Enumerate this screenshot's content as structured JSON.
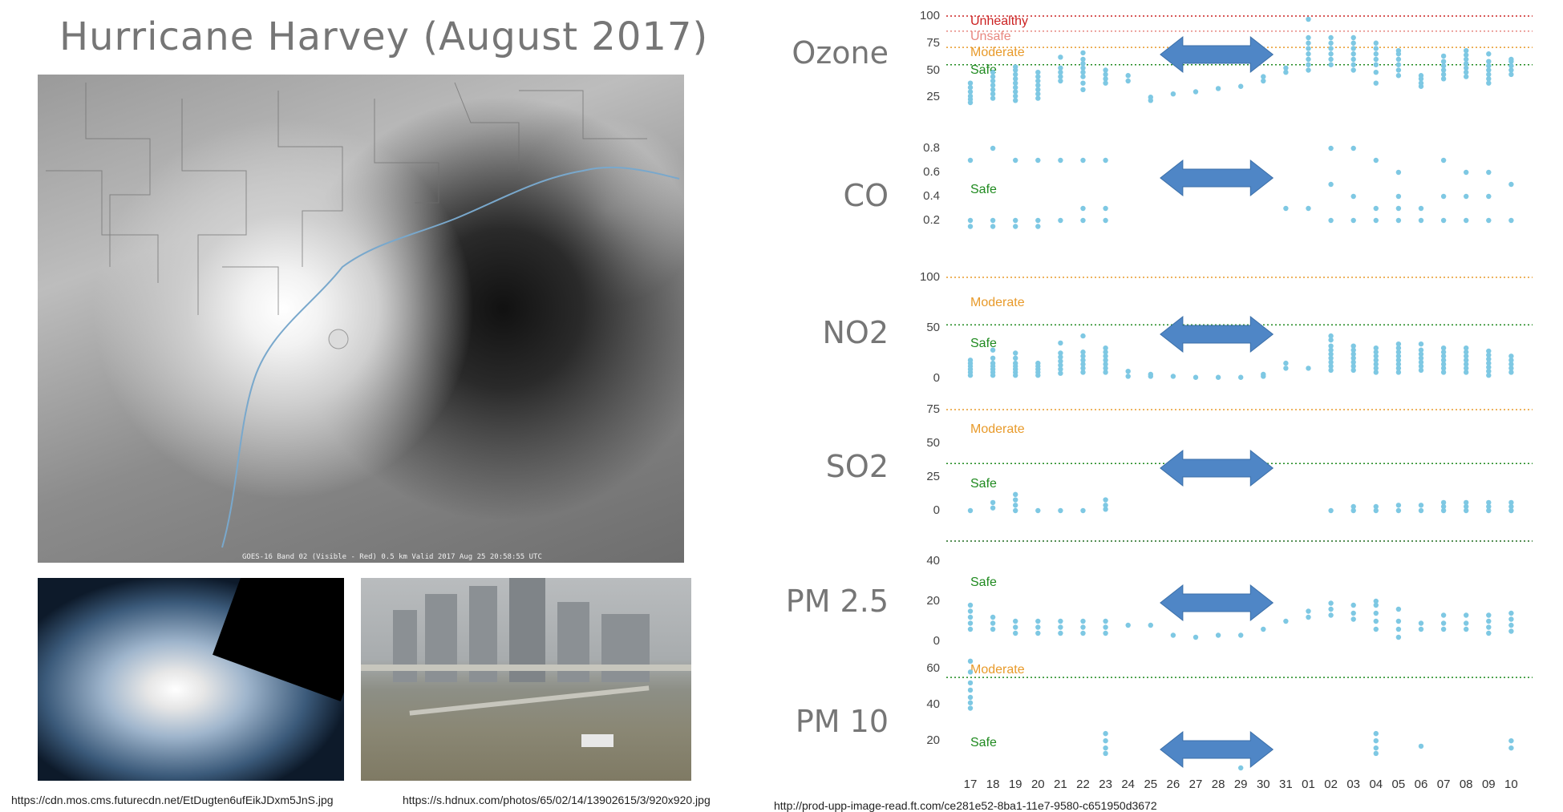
{
  "title": "Hurricane Harvey (August 2017)",
  "images": {
    "satellite_caption": "GOES-16 Band 02 (Visible - Red) 0.5 km Valid 2017 Aug 25 20:58:55 UTC"
  },
  "urls": [
    "https://cdn.mos.cms.futurecdn.net/EtDugten6ufEikJDxm5JnS.jpg",
    "https://s.hdnux.com/photos/65/02/14/13902615/3/920x920.jpg",
    "http://prod-upp-image-read.ft.com/ce281e52-8ba1-11e7-9580-c651950d3672"
  ],
  "colors": {
    "points": "#7ec8e3",
    "arrow": "#4f86c6",
    "unhealthy": "#cc2222",
    "unsafe": "#e88880",
    "moderate": "#e89a2a",
    "safe": "#1f8a1f"
  },
  "chart_data": {
    "type": "scatter",
    "x_categories": [
      "17",
      "18",
      "19",
      "20",
      "21",
      "22",
      "23",
      "24",
      "25",
      "26",
      "27",
      "28",
      "29",
      "30",
      "31",
      "01",
      "02",
      "03",
      "04",
      "05",
      "06",
      "07",
      "08",
      "09",
      "10"
    ],
    "gap_arrow": {
      "from": "26",
      "to": "30"
    },
    "panels": [
      {
        "name": "Ozone",
        "yticks": [
          "100",
          "75",
          "50",
          "25"
        ],
        "ylim": [
          0,
          100
        ],
        "thresholds": [
          {
            "label": "Unhealthy",
            "value": 100,
            "color": "#cc2222"
          },
          {
            "label": "Unsafe",
            "value": 86,
            "color": "#e88880"
          },
          {
            "label": "Moderate",
            "value": 71,
            "color": "#e89a2a"
          },
          {
            "label": "Safe",
            "value": 55,
            "color": "#1f8a1f"
          }
        ],
        "points": [
          [
            0,
            [
              20,
              23,
              26,
              30,
              34,
              38
            ]
          ],
          [
            1,
            [
              24,
              28,
              32,
              36,
              40,
              44,
              48
            ]
          ],
          [
            2,
            [
              22,
              26,
              30,
              34,
              38,
              42,
              46,
              50,
              53
            ]
          ],
          [
            3,
            [
              24,
              28,
              32,
              36,
              40,
              44,
              48
            ]
          ],
          [
            4,
            [
              40,
              44,
              48,
              52,
              62
            ]
          ],
          [
            5,
            [
              32,
              38,
              44,
              48,
              52,
              56,
              60,
              66
            ]
          ],
          [
            6,
            [
              38,
              42,
              46,
              50
            ]
          ],
          [
            7,
            [
              40,
              45
            ]
          ],
          [
            8,
            [
              22,
              25
            ]
          ],
          [
            9,
            [
              28
            ]
          ],
          [
            10,
            [
              30
            ]
          ],
          [
            11,
            [
              33
            ]
          ],
          [
            12,
            [
              35
            ]
          ],
          [
            13,
            [
              40,
              44
            ]
          ],
          [
            14,
            [
              48,
              52
            ]
          ],
          [
            15,
            [
              50,
              55,
              60,
              65,
              70,
              75,
              80,
              97
            ]
          ],
          [
            16,
            [
              55,
              60,
              65,
              70,
              75,
              80
            ]
          ],
          [
            17,
            [
              50,
              55,
              60,
              65,
              70,
              75,
              80
            ]
          ],
          [
            18,
            [
              38,
              48,
              55,
              60,
              65,
              70,
              75
            ]
          ],
          [
            19,
            [
              45,
              50,
              55,
              60,
              65,
              68
            ]
          ],
          [
            20,
            [
              35,
              38,
              42,
              45
            ]
          ],
          [
            21,
            [
              42,
              46,
              50,
              54,
              58,
              63
            ]
          ],
          [
            22,
            [
              44,
              48,
              52,
              56,
              60,
              64,
              68
            ]
          ],
          [
            23,
            [
              38,
              42,
              46,
              50,
              54,
              58,
              65
            ]
          ],
          [
            24,
            [
              46,
              50,
              54,
              58,
              60
            ]
          ]
        ]
      },
      {
        "name": "CO",
        "yticks": [
          "0.8",
          "0.6",
          "0.4",
          "0.2"
        ],
        "ylim": [
          0,
          0.9
        ],
        "thresholds": [
          {
            "label": "Safe",
            "value": 0.5,
            "color": "#1f8a1f",
            "noline": true
          }
        ],
        "points": [
          [
            0,
            [
              0.15,
              0.2,
              0.7
            ]
          ],
          [
            1,
            [
              0.15,
              0.2,
              0.8
            ]
          ],
          [
            2,
            [
              0.15,
              0.2,
              0.7
            ]
          ],
          [
            3,
            [
              0.15,
              0.2,
              0.7
            ]
          ],
          [
            4,
            [
              0.2,
              0.7
            ]
          ],
          [
            5,
            [
              0.2,
              0.3,
              0.7
            ]
          ],
          [
            6,
            [
              0.2,
              0.3,
              0.7
            ]
          ],
          [
            14,
            [
              0.3
            ]
          ],
          [
            15,
            [
              0.3
            ]
          ],
          [
            16,
            [
              0.2,
              0.5,
              0.8
            ]
          ],
          [
            17,
            [
              0.2,
              0.4,
              0.8
            ]
          ],
          [
            18,
            [
              0.2,
              0.3,
              0.7
            ]
          ],
          [
            19,
            [
              0.2,
              0.3,
              0.4,
              0.6
            ]
          ],
          [
            20,
            [
              0.2,
              0.3
            ]
          ],
          [
            21,
            [
              0.2,
              0.4,
              0.7
            ]
          ],
          [
            22,
            [
              0.2,
              0.4,
              0.6
            ]
          ],
          [
            23,
            [
              0.2,
              0.4,
              0.6
            ]
          ],
          [
            24,
            [
              0.2,
              0.5
            ]
          ]
        ]
      },
      {
        "name": "NO2",
        "yticks": [
          "100",
          "50",
          "0"
        ],
        "ylim": [
          0,
          100
        ],
        "thresholds": [
          {
            "label": "Moderate",
            "value": 100,
            "color": "#e89a2a",
            "labelValue": 80
          },
          {
            "label": "Safe",
            "value": 53,
            "color": "#1f8a1f",
            "labelValue": 40
          }
        ],
        "points": [
          [
            0,
            [
              3,
              6,
              9,
              12,
              15,
              18
            ]
          ],
          [
            1,
            [
              3,
              6,
              9,
              12,
              15,
              20,
              28
            ]
          ],
          [
            2,
            [
              3,
              6,
              9,
              12,
              15,
              20,
              25
            ]
          ],
          [
            3,
            [
              3,
              6,
              9,
              12,
              15
            ]
          ],
          [
            4,
            [
              5,
              9,
              13,
              17,
              21,
              25,
              35
            ]
          ],
          [
            5,
            [
              6,
              10,
              14,
              18,
              22,
              26,
              42
            ]
          ],
          [
            6,
            [
              6,
              10,
              14,
              18,
              22,
              26,
              30
            ]
          ],
          [
            7,
            [
              2,
              7
            ]
          ],
          [
            8,
            [
              2,
              4
            ]
          ],
          [
            9,
            [
              2
            ]
          ],
          [
            10,
            [
              1
            ]
          ],
          [
            11,
            [
              1
            ]
          ],
          [
            12,
            [
              1
            ]
          ],
          [
            13,
            [
              2,
              4
            ]
          ],
          [
            14,
            [
              10,
              15
            ]
          ],
          [
            15,
            [
              10
            ]
          ],
          [
            16,
            [
              8,
              12,
              16,
              20,
              24,
              28,
              32,
              38,
              42
            ]
          ],
          [
            17,
            [
              8,
              12,
              16,
              20,
              24,
              28,
              32
            ]
          ],
          [
            18,
            [
              6,
              10,
              14,
              18,
              22,
              26,
              30
            ]
          ],
          [
            19,
            [
              6,
              10,
              14,
              18,
              22,
              26,
              30,
              34
            ]
          ],
          [
            20,
            [
              8,
              12,
              16,
              20,
              24,
              28,
              34
            ]
          ],
          [
            21,
            [
              6,
              10,
              14,
              18,
              22,
              26,
              30
            ]
          ],
          [
            22,
            [
              6,
              10,
              14,
              18,
              22,
              26,
              30
            ]
          ],
          [
            23,
            [
              3,
              7,
              11,
              15,
              19,
              23,
              27
            ]
          ],
          [
            24,
            [
              6,
              10,
              14,
              18,
              22
            ]
          ]
        ]
      },
      {
        "name": "SO2",
        "yticks": [
          "75",
          "50",
          "25",
          "0"
        ],
        "ylim": [
          0,
          75
        ],
        "thresholds": [
          {
            "label": "Moderate",
            "value": 75,
            "color": "#e89a2a",
            "labelValue": 64
          },
          {
            "label": "Safe",
            "value": 35,
            "color": "#1f8a1f",
            "labelValue": 24
          }
        ],
        "points": [
          [
            0,
            [
              0
            ]
          ],
          [
            1,
            [
              2,
              6
            ]
          ],
          [
            2,
            [
              0,
              4,
              8,
              12
            ]
          ],
          [
            3,
            [
              0
            ]
          ],
          [
            4,
            [
              0
            ]
          ],
          [
            5,
            [
              0
            ]
          ],
          [
            6,
            [
              1,
              4,
              8
            ]
          ],
          [
            16,
            [
              0
            ]
          ],
          [
            17,
            [
              0,
              3
            ]
          ],
          [
            18,
            [
              0,
              3
            ]
          ],
          [
            19,
            [
              0,
              4
            ]
          ],
          [
            20,
            [
              0,
              4
            ]
          ],
          [
            21,
            [
              0,
              3,
              6
            ]
          ],
          [
            22,
            [
              0,
              3,
              6
            ]
          ],
          [
            23,
            [
              0,
              3,
              6
            ]
          ],
          [
            24,
            [
              0,
              3,
              6
            ]
          ]
        ]
      },
      {
        "name": "PM 2.5",
        "yticks": [
          "40",
          "20",
          "0"
        ],
        "ylim": [
          0,
          40
        ],
        "thresholds": [
          {
            "label": "Safe",
            "value": 32,
            "color": "#1f8a1f",
            "noline": true
          }
        ],
        "points": [
          [
            0,
            [
              6,
              9,
              12,
              15,
              18
            ]
          ],
          [
            1,
            [
              6,
              9,
              12
            ]
          ],
          [
            2,
            [
              4,
              7,
              10
            ]
          ],
          [
            3,
            [
              4,
              7,
              10
            ]
          ],
          [
            4,
            [
              4,
              7,
              10
            ]
          ],
          [
            5,
            [
              4,
              7,
              10
            ]
          ],
          [
            6,
            [
              4,
              7,
              10
            ]
          ],
          [
            7,
            [
              8
            ]
          ],
          [
            8,
            [
              8
            ]
          ],
          [
            9,
            [
              3
            ]
          ],
          [
            10,
            [
              2
            ]
          ],
          [
            11,
            [
              3
            ]
          ],
          [
            12,
            [
              3
            ]
          ],
          [
            13,
            [
              6
            ]
          ],
          [
            14,
            [
              10
            ]
          ],
          [
            15,
            [
              12,
              15
            ]
          ],
          [
            16,
            [
              13,
              16,
              19
            ]
          ],
          [
            17,
            [
              11,
              14,
              18
            ]
          ],
          [
            18,
            [
              6,
              10,
              14,
              18,
              20
            ]
          ],
          [
            19,
            [
              2,
              6,
              10,
              16
            ]
          ],
          [
            20,
            [
              6,
              9
            ]
          ],
          [
            21,
            [
              6,
              9,
              13
            ]
          ],
          [
            22,
            [
              6,
              9,
              13
            ]
          ],
          [
            23,
            [
              4,
              7,
              10,
              13
            ]
          ],
          [
            24,
            [
              5,
              8,
              11,
              14
            ]
          ]
        ]
      },
      {
        "name": "PM 10",
        "yticks": [
          "60",
          "40",
          "20"
        ],
        "ylim": [
          5,
          75
        ],
        "thresholds": [
          {
            "label": "Moderate",
            "value": 55,
            "color": "#e89a2a",
            "noline": true,
            "labelValue": 62
          },
          {
            "label": "Safe",
            "value": 55,
            "color": "#1f8a1f",
            "labelValue": 22
          }
        ],
        "points": [
          [
            0,
            [
              38,
              41,
              44,
              48,
              52,
              58,
              64
            ]
          ],
          [
            6,
            [
              13,
              16,
              20,
              24
            ]
          ],
          [
            12,
            [
              5
            ]
          ],
          [
            18,
            [
              13,
              16,
              20,
              24
            ]
          ],
          [
            20,
            [
              17
            ]
          ],
          [
            24,
            [
              16,
              20
            ]
          ]
        ]
      }
    ]
  }
}
